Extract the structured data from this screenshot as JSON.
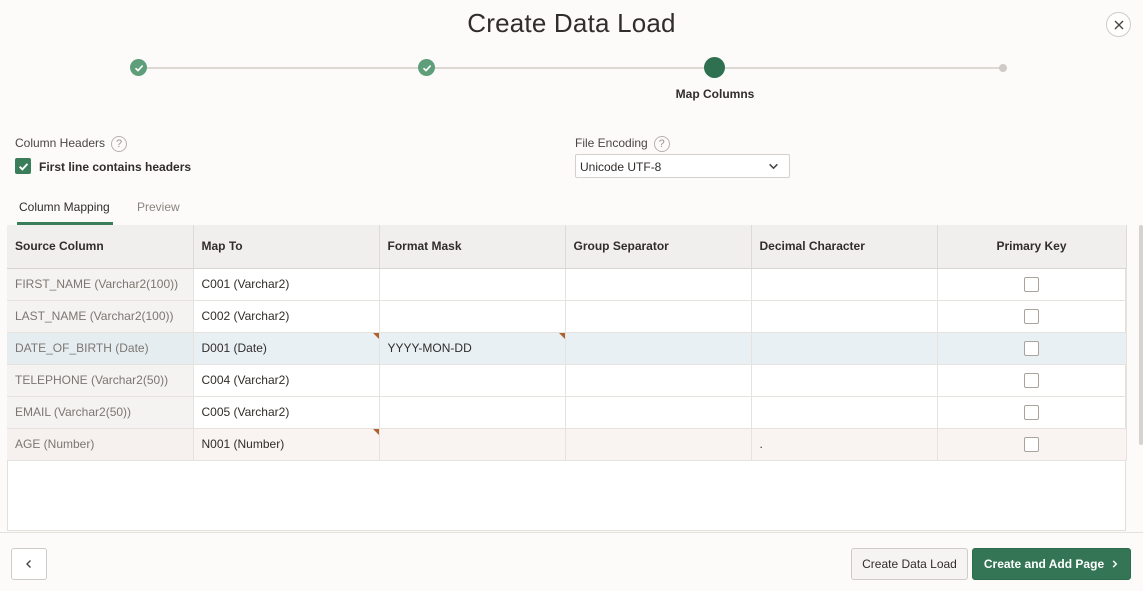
{
  "dialog": {
    "title": "Create Data Load",
    "close_icon": "close-icon"
  },
  "wizard": {
    "steps": [
      {
        "state": "completed",
        "icon": "check-icon"
      },
      {
        "state": "completed",
        "icon": "check-icon"
      },
      {
        "state": "current",
        "label": "Map Columns"
      },
      {
        "state": "upcoming"
      }
    ]
  },
  "form": {
    "column_headers_label": "Column Headers",
    "help_glyph": "?",
    "first_line_checkbox_label": "First line contains headers",
    "first_line_checked": true,
    "file_encoding_label": "File Encoding",
    "file_encoding_value": "Unicode UTF-8"
  },
  "tabs": [
    {
      "label": "Column Mapping",
      "active": true
    },
    {
      "label": "Preview",
      "active": false
    }
  ],
  "table": {
    "headers": [
      "Source Column",
      "Map To",
      "Format Mask",
      "Group Separator",
      "Decimal Character",
      "Primary Key"
    ],
    "rows": [
      {
        "source": "FIRST_NAME (Varchar2(100))",
        "map_to": "C001 (Varchar2)",
        "format_mask": "",
        "group_sep": "",
        "decimal": "",
        "primary_key": false
      },
      {
        "source": "LAST_NAME (Varchar2(100))",
        "map_to": "C002 (Varchar2)",
        "format_mask": "",
        "group_sep": "",
        "decimal": "",
        "primary_key": false
      },
      {
        "source": "DATE_OF_BIRTH (Date)",
        "map_to": "D001 (Date)",
        "format_mask": "YYYY-MON-DD",
        "group_sep": "",
        "decimal": "",
        "primary_key": false
      },
      {
        "source": "TELEPHONE (Varchar2(50))",
        "map_to": "C004 (Varchar2)",
        "format_mask": "",
        "group_sep": "",
        "decimal": "",
        "primary_key": false
      },
      {
        "source": "EMAIL (Varchar2(50))",
        "map_to": "C005 (Varchar2)",
        "format_mask": "",
        "group_sep": "",
        "decimal": "",
        "primary_key": false
      },
      {
        "source": "AGE (Number)",
        "map_to": "N001 (Number)",
        "format_mask": "",
        "group_sep": "",
        "decimal": ".",
        "primary_key": false
      }
    ]
  },
  "footer": {
    "back_icon": "chevron-left-icon",
    "create_data_load_label": "Create Data Load",
    "create_and_add_page_label": "Create and Add Page",
    "primary_chevron": "chevron-right-icon"
  },
  "colors": {
    "accent": "#347555",
    "completed_step": "#5f9e7a",
    "current_step": "#2e7050",
    "changed_cell_flag": "#b0622e",
    "selected_row": "#e9f0f4"
  }
}
